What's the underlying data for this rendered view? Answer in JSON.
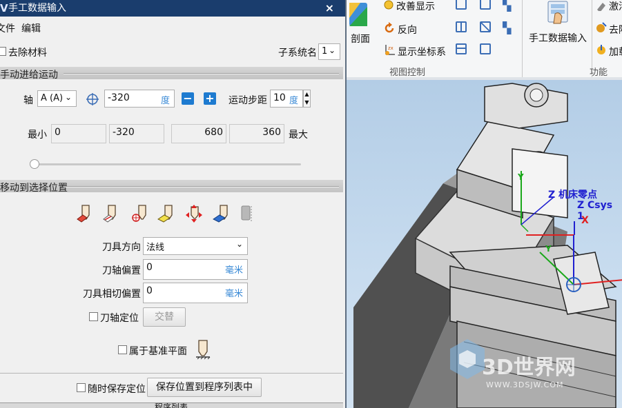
{
  "dialog": {
    "title": "手工数据输入",
    "close": "×",
    "menu": [
      "文件",
      "编辑"
    ],
    "remove_material": "去除材料",
    "subsystem_label": "子系统名",
    "subsystem_value": "1",
    "section_manual": "手动进给运动",
    "axis_label": "轴",
    "axis_value": "A (A)",
    "axis_input": "-320",
    "axis_unit": "度",
    "step_label": "运动步距",
    "step_value": "10",
    "step_unit": "度",
    "min_label": "最小",
    "max_label": "最大",
    "range_values": [
      "0",
      "-320",
      "680",
      "360"
    ],
    "slider_position": 0,
    "section_move": "移动到选择位置",
    "tool_direction_label": "刀具方向",
    "tool_direction_value": "法线",
    "axis_offset_label": "刀轴偏置",
    "axis_offset_value": "0",
    "axis_offset_unit": "毫米",
    "tangent_offset_label": "刀具相切偏置",
    "tangent_offset_value": "0",
    "tangent_offset_unit": "毫米",
    "axis_locate_label": "刀轴定位",
    "alternate_button": "交替",
    "belongs_plane_label": "属于基准平面",
    "save_anytime_label": "随时保存定位",
    "save_to_list_button": "保存位置到程序列表中",
    "program_list_label": "程序列表"
  },
  "ribbon": {
    "section_view": "剖面",
    "improve_display": "改善显示",
    "reverse": "反向",
    "show_csys": "显示坐标系",
    "view_control_group": "视图控制",
    "manual_input": "手工数据输入",
    "activate": "激活",
    "remove": "去除",
    "load": "加载",
    "function_group": "功能"
  },
  "viewport": {
    "label_machine_zero": "Z 机床零点",
    "label_csys": "Z Csys 1",
    "label_x": "X",
    "label_y1": "Y",
    "label_y2": "Y",
    "watermark_main": "3D世界网",
    "watermark_sub": "WWW.3DSJW.COM"
  },
  "colors": {
    "title_bar": "#1a3d6d",
    "accent_blue": "#1e7bd0",
    "axis_red": "#e02020",
    "axis_green": "#1aa81a",
    "axis_blue": "#2020d0"
  }
}
